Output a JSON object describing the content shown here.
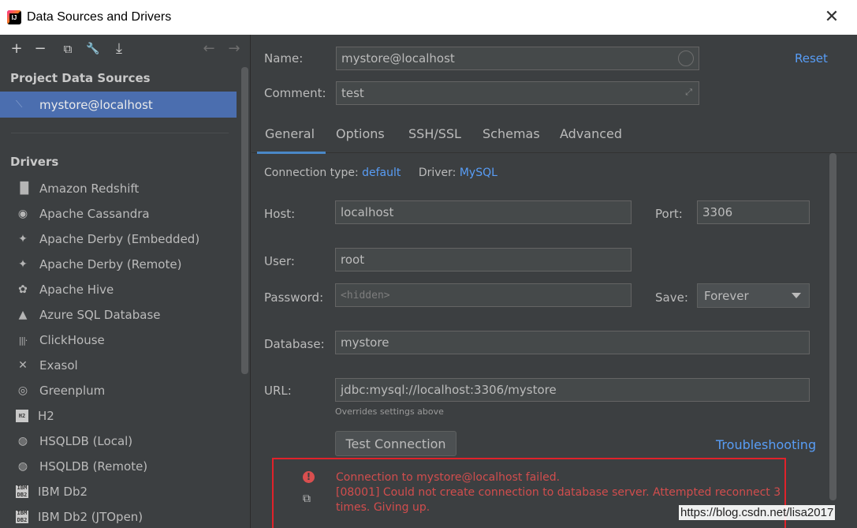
{
  "window": {
    "title": "Data Sources and Drivers"
  },
  "toolbar": {
    "add": "+",
    "remove": "−",
    "copy": "⧉",
    "wrench": "🔧",
    "import": "⤓",
    "back": "←",
    "forward": "→"
  },
  "left": {
    "project_section": "Project Data Sources",
    "project_items": [
      {
        "label": "mystore@localhost"
      }
    ],
    "drivers_section": "Drivers",
    "drivers": [
      {
        "label": "Amazon Redshift",
        "icon": "▐▌"
      },
      {
        "label": "Apache Cassandra",
        "icon": "◉"
      },
      {
        "label": "Apache Derby (Embedded)",
        "icon": "✦"
      },
      {
        "label": "Apache Derby (Remote)",
        "icon": "✦"
      },
      {
        "label": "Apache Hive",
        "icon": "✿"
      },
      {
        "label": "Azure SQL Database",
        "icon": "▲"
      },
      {
        "label": "ClickHouse",
        "icon": "|||·"
      },
      {
        "label": "Exasol",
        "icon": "✕"
      },
      {
        "label": "Greenplum",
        "icon": "◎"
      },
      {
        "label": "H2",
        "icon": "H2"
      },
      {
        "label": "HSQLDB (Local)",
        "icon": "◍"
      },
      {
        "label": "HSQLDB (Remote)",
        "icon": "◍"
      },
      {
        "label": "IBM Db2",
        "icon": "IBM DB2"
      },
      {
        "label": "IBM Db2 (JTOpen)",
        "icon": "IBM DB2"
      }
    ]
  },
  "form": {
    "name_label": "Name:",
    "name_value": "mystore@localhost",
    "reset_link": "Reset",
    "comment_label": "Comment:",
    "comment_value": "test",
    "tabs": [
      {
        "label": "General"
      },
      {
        "label": "Options"
      },
      {
        "label": "SSH/SSL"
      },
      {
        "label": "Schemas"
      },
      {
        "label": "Advanced"
      }
    ],
    "connection_type_label": "Connection type:",
    "connection_type_value": "default",
    "driver_label": "Driver:",
    "driver_value": "MySQL",
    "host_label": "Host:",
    "host_value": "localhost",
    "port_label": "Port:",
    "port_value": "3306",
    "user_label": "User:",
    "user_value": "root",
    "password_label": "Password:",
    "password_placeholder": "<hidden>",
    "save_label": "Save:",
    "save_value": "Forever",
    "database_label": "Database:",
    "database_value": "mystore",
    "url_label": "URL:",
    "url_value": "jdbc:mysql://localhost:3306/mystore",
    "url_hint": "Overrides settings above",
    "test_button": "Test Connection",
    "troubleshooting_link": "Troubleshooting",
    "error_line1": "Connection to mystore@localhost failed.",
    "error_line2": "[08001] Could not create connection to database server. Attempted reconnect 3 times. Giving up."
  },
  "watermark": "https://blog.csdn.net/lisa2017",
  "colors": {
    "accent": "#589df6",
    "selection": "#4b6eaf",
    "error": "#d14d4d",
    "error_border": "#e0222a",
    "background": "#3c3f41"
  }
}
